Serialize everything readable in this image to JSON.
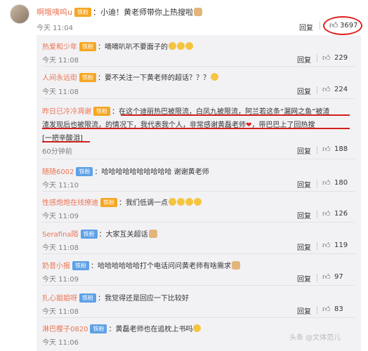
{
  "top_comment": {
    "username": "啊哦咦呜u",
    "badge": "铁粉",
    "content": "：小迪！黄老师带你上热搜啦",
    "time": "今天 11:04",
    "reply_label": "回复",
    "likes": "3697"
  },
  "replies": [
    {
      "username": "热爱和少年",
      "badge": "铁粉",
      "badge_color": "orange",
      "content": "：嘀嘀叭叭不要面子的",
      "emojis": "three-faces",
      "time": "今天 11:08",
      "reply_label": "回复",
      "likes": "229"
    },
    {
      "username": "人间永远街",
      "badge": "铁粉",
      "badge_color": "orange",
      "content": "：要不关注一下黄老师的超话？？？",
      "emojis": "laugh",
      "time": "今天 11:08",
      "reply_label": "回复",
      "likes": "224"
    },
    {
      "username": "昨日已冷冷凋谢",
      "badge": "铁粉",
      "badge_color": "orange",
      "content_line1": "：在这个迪丽热巴被限流，白凤九被限流，阿兰若这条“漏网之鱼”被渣",
      "content_line2": "渣发现后也被限流，的情况下，我代表我个人，非常感谢黄磊老师",
      "content_line2b": "，带巴巴上了回热搜",
      "content_line3": "[一把辛酸泪]",
      "time": "60分钟前",
      "reply_label": "回复",
      "likes": "188"
    },
    {
      "username": "随随6002",
      "badge": "铁粉",
      "badge_color": "blue",
      "content": "：哈哈哈哈哈哈哈哈哈哈 谢谢黄老师",
      "time": "今天 11:10",
      "reply_label": "回复",
      "likes": "180"
    },
    {
      "username": "性感炮炮在线撩迪",
      "badge": "铁粉",
      "badge_color": "orange",
      "content": "：我们低调一点",
      "emojis": "four-faces",
      "time": "今天 11:09",
      "reply_label": "回复",
      "likes": "126"
    },
    {
      "username": "Serafina陌",
      "badge": "铁粉",
      "badge_color": "blue",
      "content": "：大家互关超话",
      "emojis": "cat",
      "time": "今天 11:08",
      "reply_label": "回复",
      "likes": "119"
    },
    {
      "username": "奶音小报",
      "badge": "铁粉",
      "badge_color": "blue",
      "content": "：哈哈哈哈哈哈打个电话问问黄老师有啥需求",
      "emojis": "cat",
      "time": "今天 11:09",
      "reply_label": "回复",
      "likes": "97"
    },
    {
      "username": "扎心姐姐呀",
      "badge": "铁粉",
      "badge_color": "blue",
      "content": "：我觉得还是回应一下比较好",
      "time": "今天 11:08",
      "reply_label": "回复",
      "likes": "83"
    },
    {
      "username": "淋巴樱子0820",
      "badge": "铁粉",
      "badge_color": "blue",
      "content": "：黄磊老师也在追枕上书吗",
      "emojis": "laugh",
      "time": "今天 11:06",
      "reply_label": "回复",
      "likes": ""
    }
  ],
  "watermark": "头条 @文体范儿"
}
